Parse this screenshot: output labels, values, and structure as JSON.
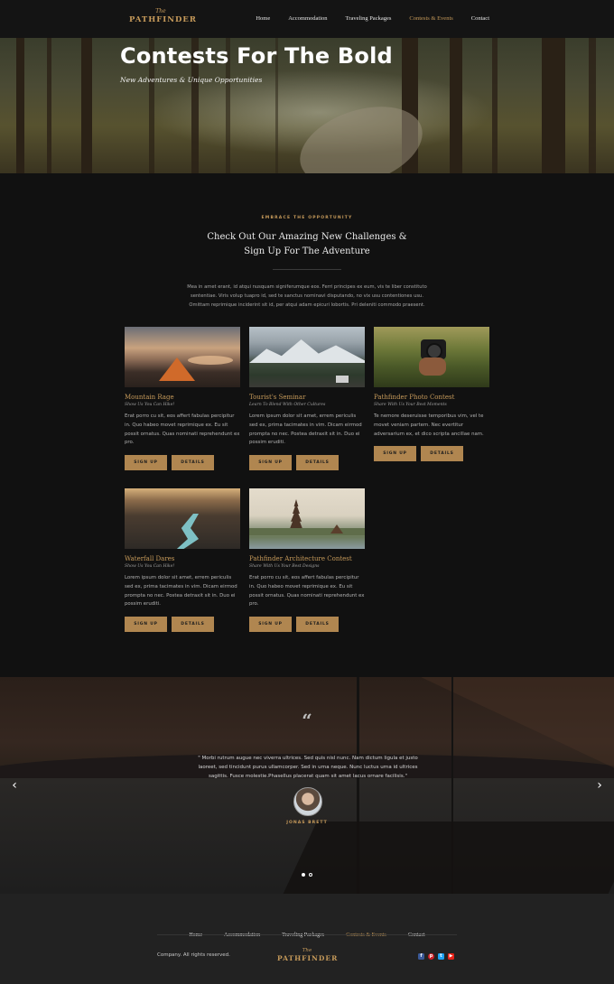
{
  "brand": {
    "the": "The",
    "name": "PATHFINDER",
    "accent_color": "#c69a5a"
  },
  "nav": {
    "items": [
      "Home",
      "Accommodation",
      "Traveling Packages",
      "Contests & Events",
      "Contact"
    ],
    "active": "Contests & Events"
  },
  "hero": {
    "title": "Contests For The Bold",
    "subtitle": "New Adventures & Unique Opportunities"
  },
  "intro": {
    "kicker": "EMBRACE THE OPPORTUNITY",
    "title_line1": "Check Out Our Amazing New Challenges &",
    "title_line2": "Sign Up For The Adventure",
    "text": "Mea in amet erant, id atqui nusquam signiferumque eos. Ferri principes ex eum, vis te liber constituto sententiae. Viris volup tuapro id, sed te sanctus nominavi disputando, no vix usu contentiones usu. Omittam reprimique inciderint sit id, per atqui adam epicuri lobortis. Pri deleniti commodo praesent."
  },
  "cards": [
    {
      "title": "Mountain Rage",
      "subtitle": "Show Us You Can Hike!",
      "text": "Erat porro cu sit, eos affert fabulas percipitur in. Quo habeo movet reprimique ex. Eu sit possit ornatus. Quas nominati reprehendunt ex pro.",
      "sign_up": "SIGN UP",
      "details": "DETAILS",
      "image": "tent-lake-sunset"
    },
    {
      "title": "Tourist's Seminar",
      "subtitle": "Learn To Blend With Other Cultures",
      "text": "Lorem ipsum dolor sit amet, errem periculis sed ex, prima tacimates in vim. Dicam eirmod prompta no nec. Postea detraxit sit in. Duo ei possim eruditi.",
      "sign_up": "SIGN UP",
      "details": "DETAILS",
      "image": "snowy-mountain-road"
    },
    {
      "title": "Pathfinder Photo Contest",
      "subtitle": "Share With Us Your Best Moments",
      "text": "Te nemore deseruisse temporibus vim, vel te movet veniam partem. Nec evertitur adversarium ex, et dico scripta ancillae nam.",
      "sign_up": "SIGN UP",
      "details": "DETAILS",
      "image": "camera-in-hand"
    },
    {
      "title": "Waterfall Dares",
      "subtitle": "Show Us You Can Hike!",
      "text": "Lorem ipsum dolor sit amet, errem periculis sed ex, prima tacimates in vim. Dicam eirmod prompta no nec. Postea detraxit sit in. Duo ei possim eruditi.",
      "sign_up": "SIGN UP",
      "details": "DETAILS",
      "image": "river-valley"
    },
    {
      "title": "Pathfinder Architecture Contest",
      "subtitle": "Share With Us Your Best Designs",
      "text": "Erat porro cu sit, eos affert fabulas percipitur in. Quo habeo movet reprimique ex. Eu sit possit ornatus. Quas nominati reprehendunt ex pro.",
      "sign_up": "SIGN UP",
      "details": "DETAILS",
      "image": "temple-pagoda"
    }
  ],
  "testimonial": {
    "quote_icon": "quote-icon",
    "text": "\" Morbi rutrum augue nec viverra ultrices. Sed quis nisl nunc. Nam dictum ligula et justo laoreet, sed tincidunt purus ullamcorper. Sed in urna neque. Nunc luctus urna id ultrices sagittis. Fusce molestie.Phasellus placerat quam sit amet lacus ornare facilisis.\"",
    "author": "JONAS BRETT",
    "prev": "‹",
    "next": "›",
    "slide_count": 2,
    "active_slide": 1
  },
  "footer": {
    "nav": [
      "Home",
      "Accommodation",
      "Traveling Packages",
      "Contests & Events",
      "Contact"
    ],
    "active": "Contests & Events",
    "copyright": "Company. All rights reserved.",
    "social": [
      {
        "icon": "facebook-icon",
        "color": "#3b5998"
      },
      {
        "icon": "pinterest-icon",
        "color": "#cb2027"
      },
      {
        "icon": "twitter-icon",
        "color": "#1da1f2"
      },
      {
        "icon": "youtube-icon",
        "color": "#e62117"
      }
    ]
  }
}
